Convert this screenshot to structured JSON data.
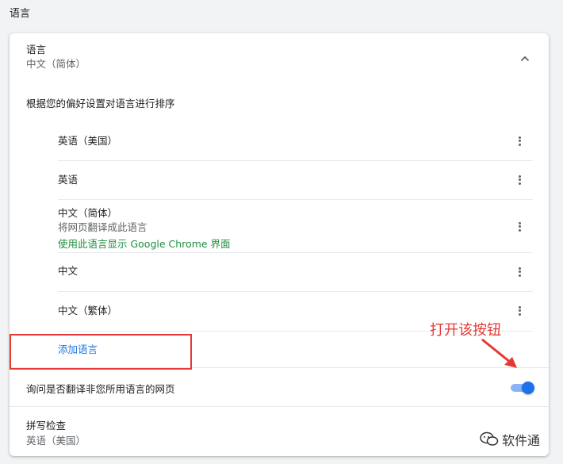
{
  "section": {
    "title": "语言"
  },
  "language": {
    "label": "语言",
    "value": "中文（简体）",
    "sort_hint": "根据您的偏好设置对语言进行排序",
    "items": [
      {
        "name": "英语（美国）"
      },
      {
        "name": "英语"
      },
      {
        "name": "中文（简体）",
        "sub": "将网页翻译成此语言",
        "note": "使用此语言显示 Google Chrome 界面"
      },
      {
        "name": "中文"
      },
      {
        "name": "中文（繁体）"
      }
    ],
    "add_label": "添加语言"
  },
  "translate": {
    "ask_label": "询问是否翻译非您所用语言的网页",
    "toggle_on": true
  },
  "spellcheck": {
    "title": "拼写检查",
    "value": "英语（美国）"
  },
  "annotation": {
    "text": "打开该按钮"
  },
  "watermark": {
    "text": "软件通"
  },
  "colors": {
    "accent": "#1a73e8",
    "green_note": "#1e8e3e",
    "annotation_red": "#e53935"
  },
  "icons": {
    "collapse": "chevron-up-icon",
    "more": "more-vert-icon",
    "watermark": "wechat-icon"
  }
}
